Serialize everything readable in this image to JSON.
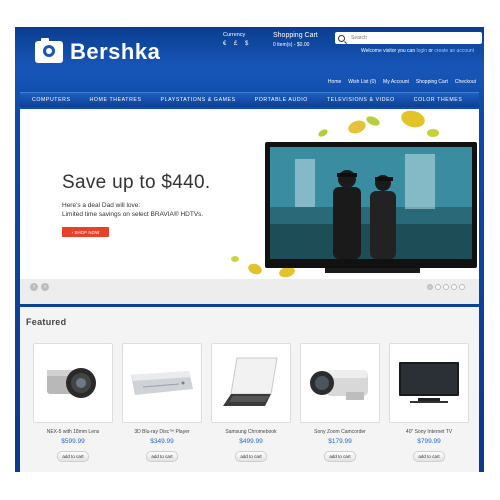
{
  "header": {
    "brand": "Bershka",
    "currency_label": "Currency",
    "currency_values": "€  £  $",
    "cart_label": "Shopping Cart",
    "cart_summary": "0 item(s) - $0.00",
    "search_placeholder": "Search",
    "welcome_text": "Welcome visitor you can",
    "login_link": "login",
    "or_text": "or",
    "register_link": "create an account"
  },
  "toplinks": [
    "Home",
    "Wish List (0)",
    "My Account",
    "Shopping Cart",
    "Checkout"
  ],
  "nav": [
    "COMPUTERS",
    "HOME THEATRES",
    "PLAYSTATIONS & GAMES",
    "PORTABLE AUDIO",
    "TELEVISIONS & VIDEO",
    "COLOR THEMES"
  ],
  "slider": {
    "headline": "Save up to $440.",
    "subline_1": "Here's a deal Dad will love:",
    "subline_2": "Limited time savings on select BRAVIA® HDTVs.",
    "cta": "› SHOP NOW",
    "prev": "‹",
    "next": "›"
  },
  "featured": {
    "title": "Featured",
    "add_label": "add to cart",
    "products": [
      {
        "name": "NEX-5 with 18mm Lens",
        "price": "$599.99",
        "icon": "camera-icon"
      },
      {
        "name": "3D Blu-ray Disc™ Player",
        "price": "$349.99",
        "icon": "bluray-player-icon"
      },
      {
        "name": "Samsung Chromebook",
        "price": "$499.99",
        "icon": "laptop-icon"
      },
      {
        "name": "Sony Zoom Camcorder",
        "price": "$179.99",
        "icon": "camcorder-icon"
      },
      {
        "name": "40\" Sony Internet TV",
        "price": "$799.99",
        "icon": "tv-icon"
      }
    ]
  },
  "colors": {
    "header_blue": "#1756b8",
    "accent_red": "#e8412a",
    "price_blue": "#2b66c8"
  }
}
